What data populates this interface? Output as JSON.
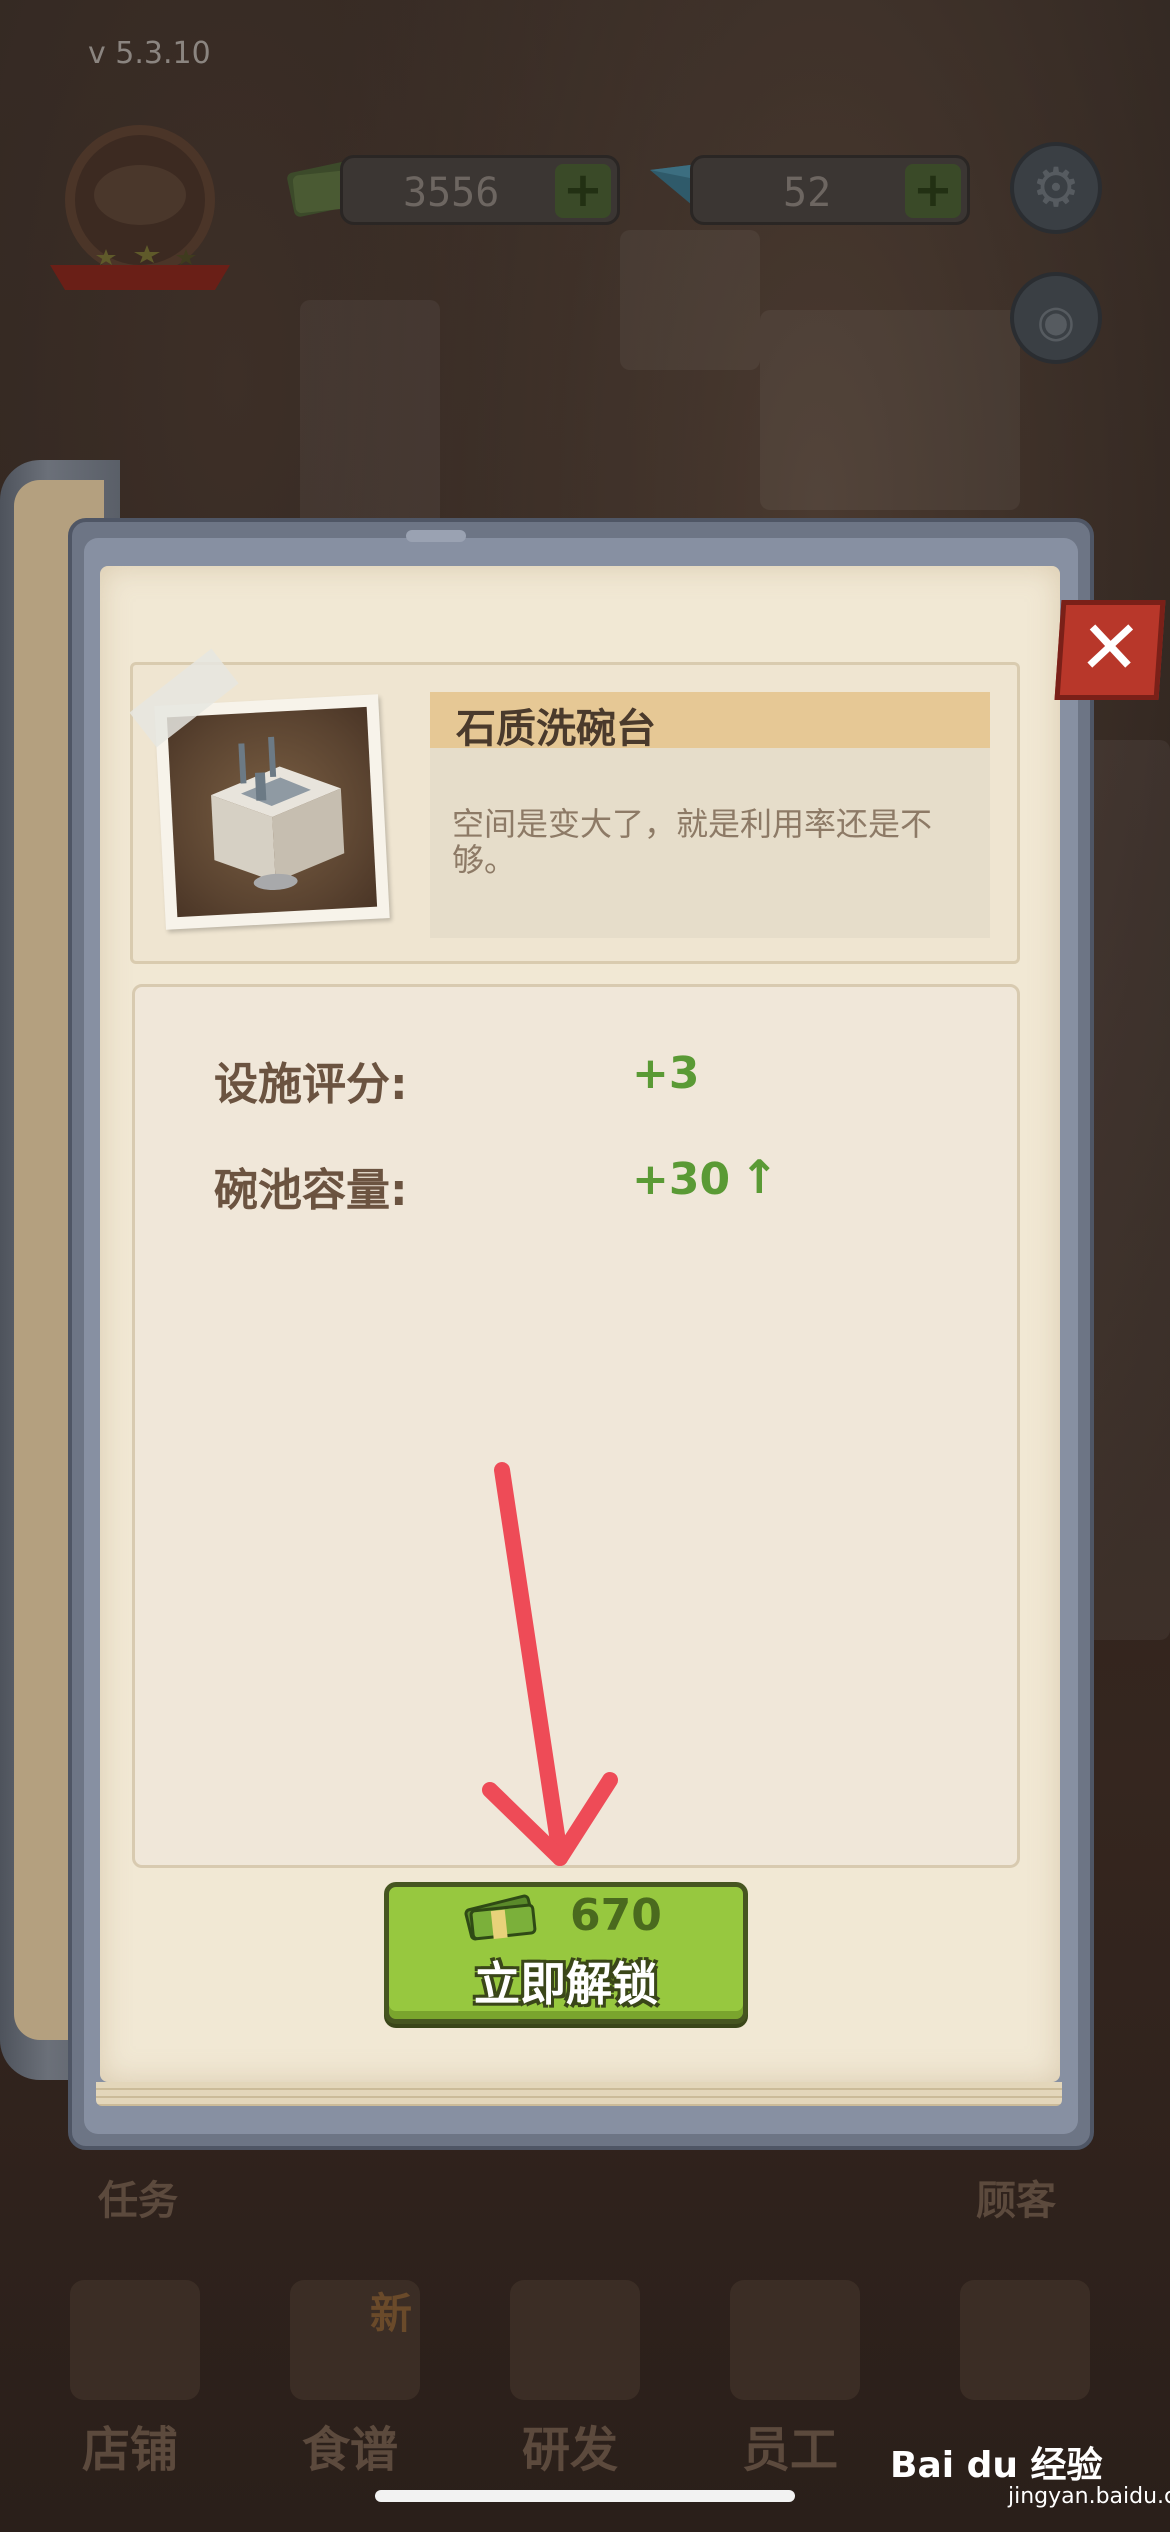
{
  "app": {
    "version": "v 5.3.10"
  },
  "hud": {
    "cash": "3556",
    "gems": "52",
    "plus": "+"
  },
  "dialog": {
    "close_glyph": "✕",
    "item": {
      "name": "石质洗碗台",
      "description": "空间是变大了，就是利用率还是不够。"
    },
    "stats": [
      {
        "label": "设施评分:",
        "value": "+3",
        "arrow": ""
      },
      {
        "label": "碗池容量:",
        "value": "+30",
        "arrow": "↑"
      }
    ],
    "unlock": {
      "price": "670",
      "label": "立即解锁"
    }
  },
  "side_labels": {
    "left": "任务",
    "right": "顾客"
  },
  "bottom_nav": [
    {
      "label": "店铺",
      "badge": ""
    },
    {
      "label": "食谱",
      "badge": "新"
    },
    {
      "label": "研发",
      "badge": ""
    },
    {
      "label": "员工",
      "badge": ""
    },
    {
      "label": "",
      "badge": ""
    }
  ],
  "watermark": {
    "text": "Bai du 经验",
    "sub": "jingyan.baidu.com"
  },
  "colors": {
    "accent_green": "#97c83f",
    "stat_green": "#5a9a35",
    "close_red": "#b8372a",
    "paper": "#f1e8d4"
  },
  "icons": [
    "cash-icon",
    "gem-icon",
    "settings-icon",
    "camera-icon",
    "close-icon",
    "up-arrow-icon"
  ]
}
